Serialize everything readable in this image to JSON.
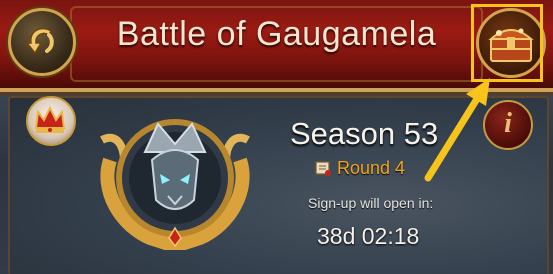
{
  "header": {
    "title": "Battle of Gaugamela",
    "back_icon": "back-arrow-icon",
    "chest_icon": "treasure-chest-icon"
  },
  "season": {
    "label": "Season 53",
    "round_label": "Round 4",
    "round_icon": "scroll-icon",
    "signup_text": "Sign-up will open in:",
    "countdown": "38d 02:18"
  },
  "side_buttons": {
    "crown_icon": "crown-icon",
    "info_glyph": "i"
  },
  "colors": {
    "header_red": "#9b1b13",
    "gold_trim": "#d3a44c",
    "highlight": "#f7c41b",
    "round_orange": "#f2a51c"
  }
}
